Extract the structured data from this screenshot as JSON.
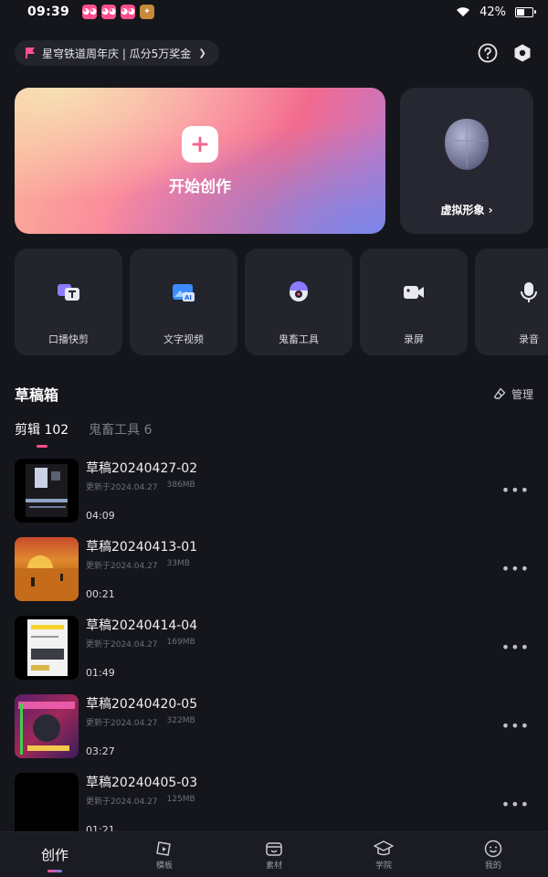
{
  "status_bar": {
    "time": "09:39",
    "battery": "42%",
    "battery_level": 0.42
  },
  "banner": {
    "text": "星穹铁道周年庆 | 瓜分5万奖金",
    "chevron": "❯"
  },
  "header_icons": [
    "help-icon",
    "settings-hex-icon"
  ],
  "create_card": {
    "label": "开始创作"
  },
  "avatar_card": {
    "label": "虚拟形象 ›"
  },
  "tools": [
    {
      "label": "口播快剪",
      "icon": "talk-edit-icon"
    },
    {
      "label": "文字视频",
      "icon": "text-video-icon"
    },
    {
      "label": "鬼畜工具",
      "icon": "remix-tool-icon"
    },
    {
      "label": "录屏",
      "icon": "screen-record-icon"
    },
    {
      "label": "录音",
      "icon": "microphone-icon"
    }
  ],
  "drafts": {
    "title": "草稿箱",
    "manage_label": "管理",
    "tabs": [
      {
        "label": "剪辑 102",
        "active": true
      },
      {
        "label": "鬼畜工具 6",
        "active": false
      }
    ],
    "items": [
      {
        "title": "草稿20240427-02",
        "updated": "更新于2024.04.27",
        "size": "386MB",
        "duration": "04:09",
        "thumb": "screen-dark"
      },
      {
        "title": "草稿20240413-01",
        "updated": "更新于2024.04.27",
        "size": "33MB",
        "duration": "00:21",
        "thumb": "desert-sunset"
      },
      {
        "title": "草稿20240414-04",
        "updated": "更新于2024.04.27",
        "size": "169MB",
        "duration": "01:49",
        "thumb": "screen-light"
      },
      {
        "title": "草稿20240420-05",
        "updated": "更新于2024.04.27",
        "size": "322MB",
        "duration": "03:27",
        "thumb": "game-colorful"
      },
      {
        "title": "草稿20240405-03",
        "updated": "更新于2024.04.27",
        "size": "125MB",
        "duration": "01:21",
        "thumb": "black"
      }
    ],
    "more_label": "•••"
  },
  "bottom_nav": [
    {
      "label": "创作",
      "icon": "create-icon",
      "active": true
    },
    {
      "label": "模板",
      "icon": "template-icon",
      "active": false
    },
    {
      "label": "素材",
      "icon": "material-icon",
      "active": false
    },
    {
      "label": "学院",
      "icon": "academy-icon",
      "active": false
    },
    {
      "label": "我的",
      "icon": "profile-icon",
      "active": false
    }
  ],
  "colors": {
    "accent": "#ff4f8e",
    "background": "#15161c",
    "card": "#23242c"
  }
}
